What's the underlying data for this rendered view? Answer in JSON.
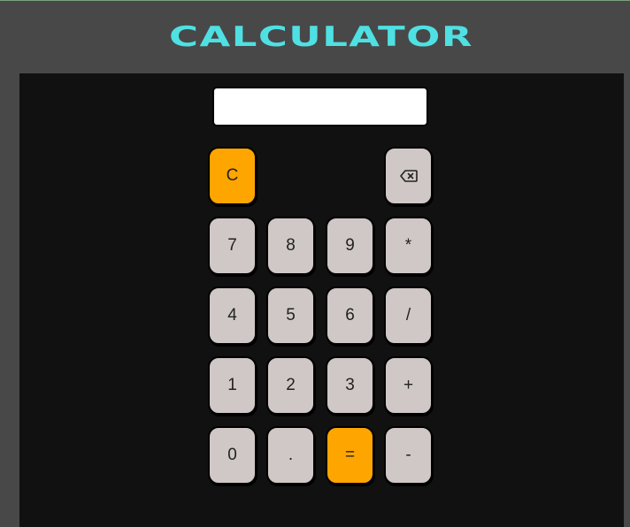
{
  "app": {
    "title": "CALCULATOR"
  },
  "display": {
    "value": ""
  },
  "keys": {
    "clear": "C",
    "backspace_icon": "backspace-icon",
    "seven": "7",
    "eight": "8",
    "nine": "9",
    "multiply": "*",
    "four": "4",
    "five": "5",
    "six": "6",
    "divide": "/",
    "one": "1",
    "two": "2",
    "three": "3",
    "plus": "+",
    "zero": "0",
    "decimal": ".",
    "equals": "=",
    "minus": "-"
  },
  "colors": {
    "title": "#4fe0e3",
    "accent_key": "#ffa500",
    "key": "#cfc8c6",
    "panel": "#111111",
    "page": "#484848"
  }
}
